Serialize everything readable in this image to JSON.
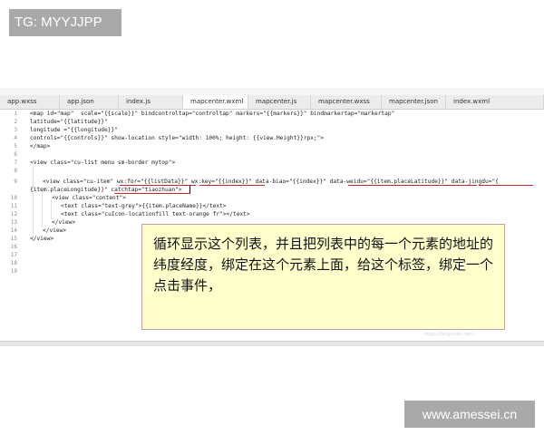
{
  "watermark_top": "TG: MYYJJPP",
  "watermark_bottom": "www.amessei.cn",
  "tabs": [
    "app.wxss",
    "app.json",
    "index.js",
    "mapcenter.wxml",
    "mapcenter.js",
    "mapcenter.wxss",
    "mapcenter.json",
    "index.wxml"
  ],
  "line_numbers": [
    "1",
    "2",
    "3",
    "4",
    "5",
    "6",
    "7",
    "8",
    "9",
    "",
    "10",
    "11",
    "12",
    "13",
    "14",
    "15",
    "16",
    "17",
    "18",
    "19"
  ],
  "code": {
    "l1a": "<map id=\"map\"  scale=\"{{scale}}\" bindcontroltap=\"controltap\" markers=\"{{markers}}\" bindmarkertap=\"markertap\"",
    "l2": "latitude=\"{{latitude}}\"",
    "l3": "longitude =\"{{longitude}}\"",
    "l4": "controls=\"{{controls}}\" show-location style=\"width: 100%; height: {{view.Height}}rpx;\">",
    "l5": "</map>",
    "l7": "<view class=\"cu-list menu sm-border mytop\">",
    "l9": "<view class=\"cu-item\" wx:for=\"{{listData}}\" wx:key=\"{{index}}\" data-biao=\"{{index}}\" data-weidu=\"{{item.placeLatitude}}\" data-jingdu=\"{",
    "l9b": "{item.placeLongitude}}\" catchtap=\"tiaozhuan\">",
    "l10": "<view class=\"content\">",
    "l11": "<text class=\"text-grey\">{{item.placeName}}</text>",
    "l12": "<text class=\"cuIcon-locationfill text-orange fr\"></text>",
    "l13": "</view>",
    "l14": "</view>",
    "l15": "</view>"
  },
  "callout_text": "循环显示这个列表，并且把列表中的每一个元素的地址的纬度经度，绑定在这个元素上面，给这个标签，绑定一个点击事件，",
  "faint_watermark": "https://blog.csdn.net/..."
}
